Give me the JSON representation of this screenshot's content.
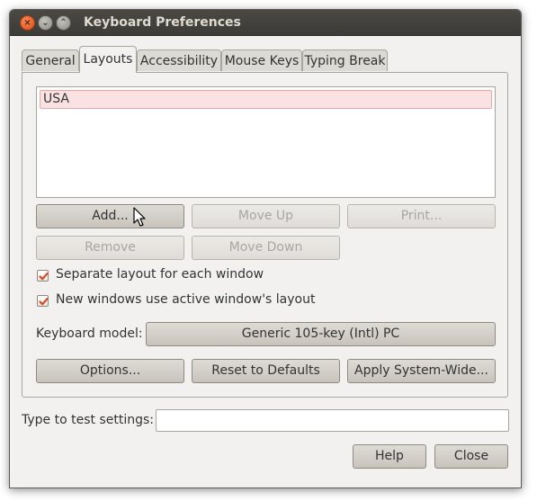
{
  "window": {
    "title": "Keyboard Preferences",
    "controls": {
      "close": "×",
      "minimize": "⌄",
      "maximize": "⌃"
    }
  },
  "tabs": [
    {
      "label": "General",
      "active": false
    },
    {
      "label": "Layouts",
      "active": true
    },
    {
      "label": "Accessibility",
      "active": false
    },
    {
      "label": "Mouse Keys",
      "active": false
    },
    {
      "label": "Typing Break",
      "active": false
    }
  ],
  "layouts": {
    "items": [
      "USA"
    ],
    "selected": "USA",
    "buttons": {
      "add": "Add...",
      "move_up": "Move Up",
      "print": "Print...",
      "remove": "Remove",
      "move_down": "Move Down"
    },
    "options": {
      "separate_layout": {
        "label": "Separate layout for each window",
        "checked": true
      },
      "new_windows_active": {
        "label": "New windows use active window's layout",
        "checked": true
      }
    },
    "keyboard_model": {
      "label": "Keyboard model:",
      "value": "Generic 105-key (Intl) PC"
    },
    "bottom_buttons": {
      "options": "Options...",
      "reset": "Reset to Defaults",
      "apply": "Apply System-Wide..."
    }
  },
  "test": {
    "label": "Type to test settings:",
    "value": ""
  },
  "dialog_buttons": {
    "help": "Help",
    "close": "Close"
  },
  "colors": {
    "titlebar": "#3c3b37",
    "selection_bg": "#fbe2e2",
    "checkbox_accent": "#d64a1e"
  }
}
